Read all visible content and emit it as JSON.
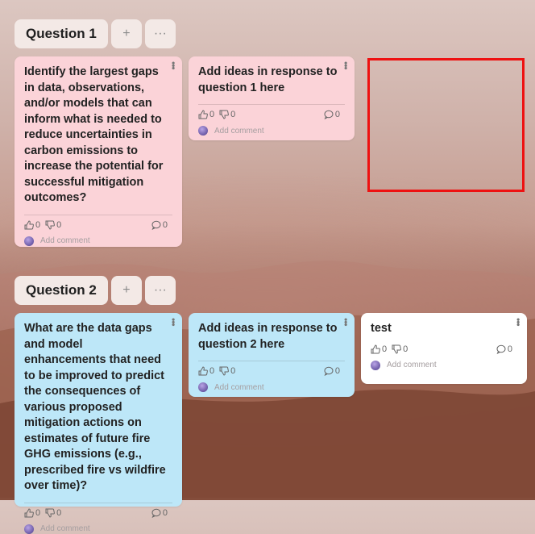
{
  "sections": [
    {
      "title": "Question 1",
      "add_label": "+",
      "more_label": "···",
      "cards": [
        {
          "color": "#fbd3d8",
          "text": "Identify the largest gaps in data, observations, and/or models that can inform what is needed to reduce uncertainties in carbon emissions to increase the potential for successful mitigation outcomes?",
          "likes": "0",
          "dislikes": "0",
          "comments": "0",
          "comment_placeholder": "Add comment"
        },
        {
          "color": "#fbd3d8",
          "text": "Add ideas in response to question 1 here",
          "likes": "0",
          "dislikes": "0",
          "comments": "0",
          "comment_placeholder": "Add comment"
        }
      ]
    },
    {
      "title": "Question 2",
      "add_label": "+",
      "more_label": "···",
      "cards": [
        {
          "color": "#bde7f8",
          "text": "What are the data gaps and model enhancements that need to be improved to predict the consequences of various proposed mitigation actions on estimates of future fire GHG emissions (e.g., prescribed fire vs wildfire over time)?",
          "likes": "0",
          "dislikes": "0",
          "comments": "0",
          "comment_placeholder": "Add comment"
        },
        {
          "color": "#bde7f8",
          "text": "Add ideas in response to question 2 here",
          "likes": "0",
          "dislikes": "0",
          "comments": "0",
          "comment_placeholder": "Add comment"
        },
        {
          "color": "#ffffff",
          "text": "test",
          "likes": "0",
          "dislikes": "0",
          "comments": "0",
          "comment_placeholder": "Add comment"
        }
      ]
    }
  ],
  "icons": {
    "like": "thumbs-up-icon",
    "dislike": "thumbs-down-icon",
    "comment": "comment-bubble-icon",
    "menu": "kebab-menu-icon",
    "avatar": "user-avatar"
  },
  "highlight_color": "#ee1111"
}
